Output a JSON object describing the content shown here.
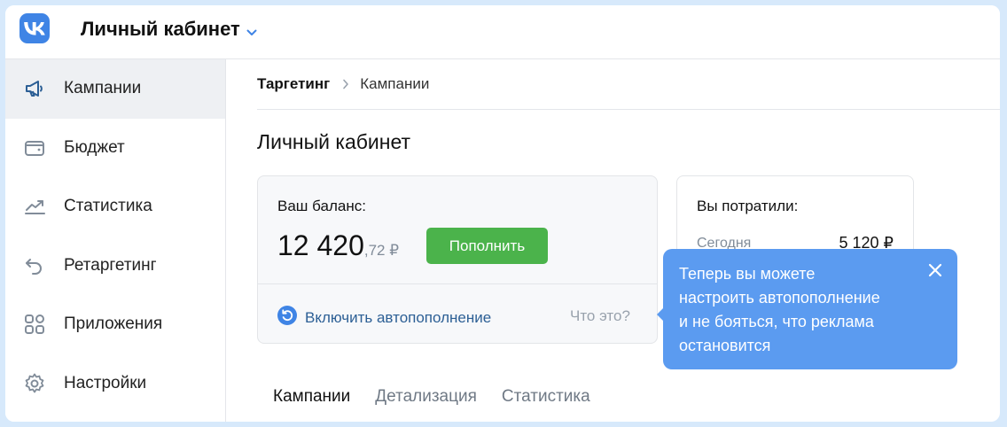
{
  "header": {
    "logo": "vk-logo",
    "title": "Личный кабинет",
    "chevron_icon": "chevron-down-icon"
  },
  "sidebar": {
    "items": [
      {
        "label": "Кампании",
        "icon": "megaphone-icon",
        "active": true
      },
      {
        "label": "Бюджет",
        "icon": "wallet-icon",
        "active": false
      },
      {
        "label": "Статистика",
        "icon": "chart-line-icon",
        "active": false
      },
      {
        "label": "Ретаргетинг",
        "icon": "undo-arrow-icon",
        "active": false
      },
      {
        "label": "Приложения",
        "icon": "apps-grid-icon",
        "active": false
      },
      {
        "label": "Настройки",
        "icon": "gear-icon",
        "active": false
      }
    ]
  },
  "breadcrumb": {
    "first": "Таргетинг",
    "second": "Кампании"
  },
  "page": {
    "title": "Личный кабинет"
  },
  "balance": {
    "label": "Ваш баланс:",
    "amount_main": "12 420",
    "amount_cents": ",72 ₽",
    "topup_button": "Пополнить",
    "autotopup_label": "Включить автопополнение",
    "what_link": "Что это?"
  },
  "spent": {
    "label": "Вы потратили:",
    "today_label": "Сегодня",
    "today_value": "5 120 ₽"
  },
  "tooltip": {
    "text_lines": [
      "Теперь вы можете",
      "настроить автопополнение",
      "и не бояться, что реклама",
      "остановится"
    ],
    "close_icon": "close-icon"
  },
  "tabs": [
    {
      "label": "Кампании",
      "active": true
    },
    {
      "label": "Детализация",
      "active": false
    },
    {
      "label": "Статистика",
      "active": false
    }
  ],
  "colors": {
    "background": "#d7e9fb",
    "accent_blue": "#3f84e5",
    "tooltip_blue": "#5b9bf0",
    "topup_green": "#4bb34b",
    "link_blue": "#2c5f95",
    "sidebar_active": "#eef0f3"
  }
}
